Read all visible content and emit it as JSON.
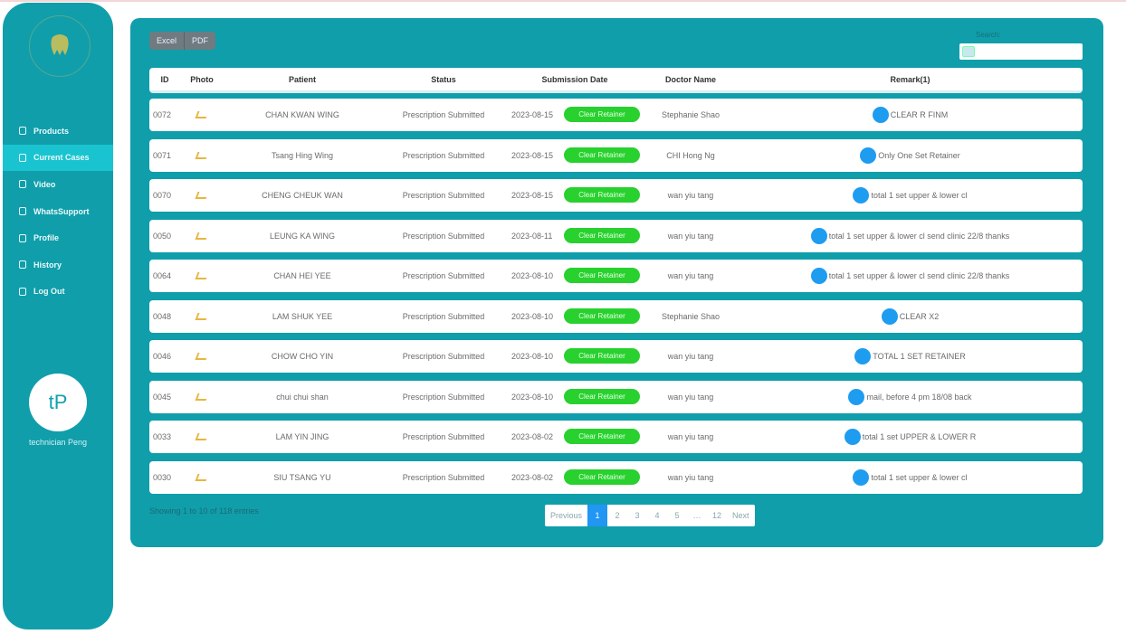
{
  "sidebar": {
    "nav": [
      {
        "label": "Products",
        "icon": "document-icon",
        "active": false
      },
      {
        "label": "Current Cases",
        "icon": "user-icon",
        "active": true
      },
      {
        "label": "Video",
        "icon": "video-icon",
        "active": false
      },
      {
        "label": "WhatsSupport",
        "icon": "chat-icon",
        "active": false
      },
      {
        "label": "Profile",
        "icon": "person-icon",
        "active": false
      },
      {
        "label": "History",
        "icon": "clock-icon",
        "active": false
      },
      {
        "label": "Log Out",
        "icon": "logout-icon",
        "active": false
      }
    ],
    "avatar_initials": "tP",
    "user_name": "technician Peng"
  },
  "toolbar": {
    "excel_label": "Excel",
    "pdf_label": "PDF",
    "search_label": "Search:",
    "search_value": ""
  },
  "table": {
    "headers": {
      "id": "ID",
      "photo": "Photo",
      "patient": "Patient",
      "status": "Status",
      "date": "Submission Date",
      "doctor": "Doctor Name",
      "remark": "Remark(1)"
    },
    "rows": [
      {
        "id": "0072",
        "patient": "CHAN KWAN WING",
        "status": "Prescription Submitted",
        "date": "2023-08-15",
        "pill": "Clear Retainer",
        "doctor": "Stephanie Shao",
        "remark": "CLEAR R FINM"
      },
      {
        "id": "0071",
        "patient": "Tsang Hing Wing",
        "status": "Prescription Submitted",
        "date": "2023-08-15",
        "pill": "Clear Retainer",
        "doctor": "CHI Hong Ng",
        "remark": "Only One Set Retainer"
      },
      {
        "id": "0070",
        "patient": "CHENG CHEUK WAN",
        "status": "Prescription Submitted",
        "date": "2023-08-15",
        "pill": "Clear Retainer",
        "doctor": "wan yiu tang",
        "remark": "total 1 set upper & lower cl"
      },
      {
        "id": "0050",
        "patient": "LEUNG KA WING",
        "status": "Prescription Submitted",
        "date": "2023-08-11",
        "pill": "Clear Retainer",
        "doctor": "wan yiu tang",
        "remark": "total 1 set upper & lower cl send clinic 22/8 thanks"
      },
      {
        "id": "0064",
        "patient": "CHAN HEI YEE",
        "status": "Prescription Submitted",
        "date": "2023-08-10",
        "pill": "Clear Retainer",
        "doctor": "wan yiu tang",
        "remark": "total 1 set upper & lower cl send clinic 22/8 thanks"
      },
      {
        "id": "0048",
        "patient": "LAM SHUK YEE",
        "status": "Prescription Submitted",
        "date": "2023-08-10",
        "pill": "Clear Retainer",
        "doctor": "Stephanie Shao",
        "remark": "CLEAR X2"
      },
      {
        "id": "0046",
        "patient": "CHOW CHO YIN",
        "status": "Prescription Submitted",
        "date": "2023-08-10",
        "pill": "Clear Retainer",
        "doctor": "wan yiu tang",
        "remark": "TOTAL 1 SET RETAINER"
      },
      {
        "id": "0045",
        "patient": "chui chui shan",
        "status": "Prescription Submitted",
        "date": "2023-08-10",
        "pill": "Clear Retainer",
        "doctor": "wan yiu tang",
        "remark": "mail, before 4 pm 18/08 back"
      },
      {
        "id": "0033",
        "patient": "LAM YIN JING",
        "status": "Prescription Submitted",
        "date": "2023-08-02",
        "pill": "Clear Retainer",
        "doctor": "wan yiu tang",
        "remark": "total 1 set UPPER & LOWER R"
      },
      {
        "id": "0030",
        "patient": "SIU TSANG YU",
        "status": "Prescription Submitted",
        "date": "2023-08-02",
        "pill": "Clear Retainer",
        "doctor": "wan yiu tang",
        "remark": "total 1 set upper & lower cl"
      }
    ]
  },
  "footer": {
    "showing": "Showing 1 to 10 of 118 entries",
    "pagination": [
      "Previous",
      "1",
      "2",
      "3",
      "4",
      "5",
      "…",
      "12",
      "Next"
    ],
    "active_page": "1"
  },
  "colors": {
    "teal": "#109eab",
    "active_nav": "#19c4d0",
    "pill_green": "#28d12e",
    "remark_dot": "#1e9cf0",
    "page_active": "#2196f3"
  }
}
